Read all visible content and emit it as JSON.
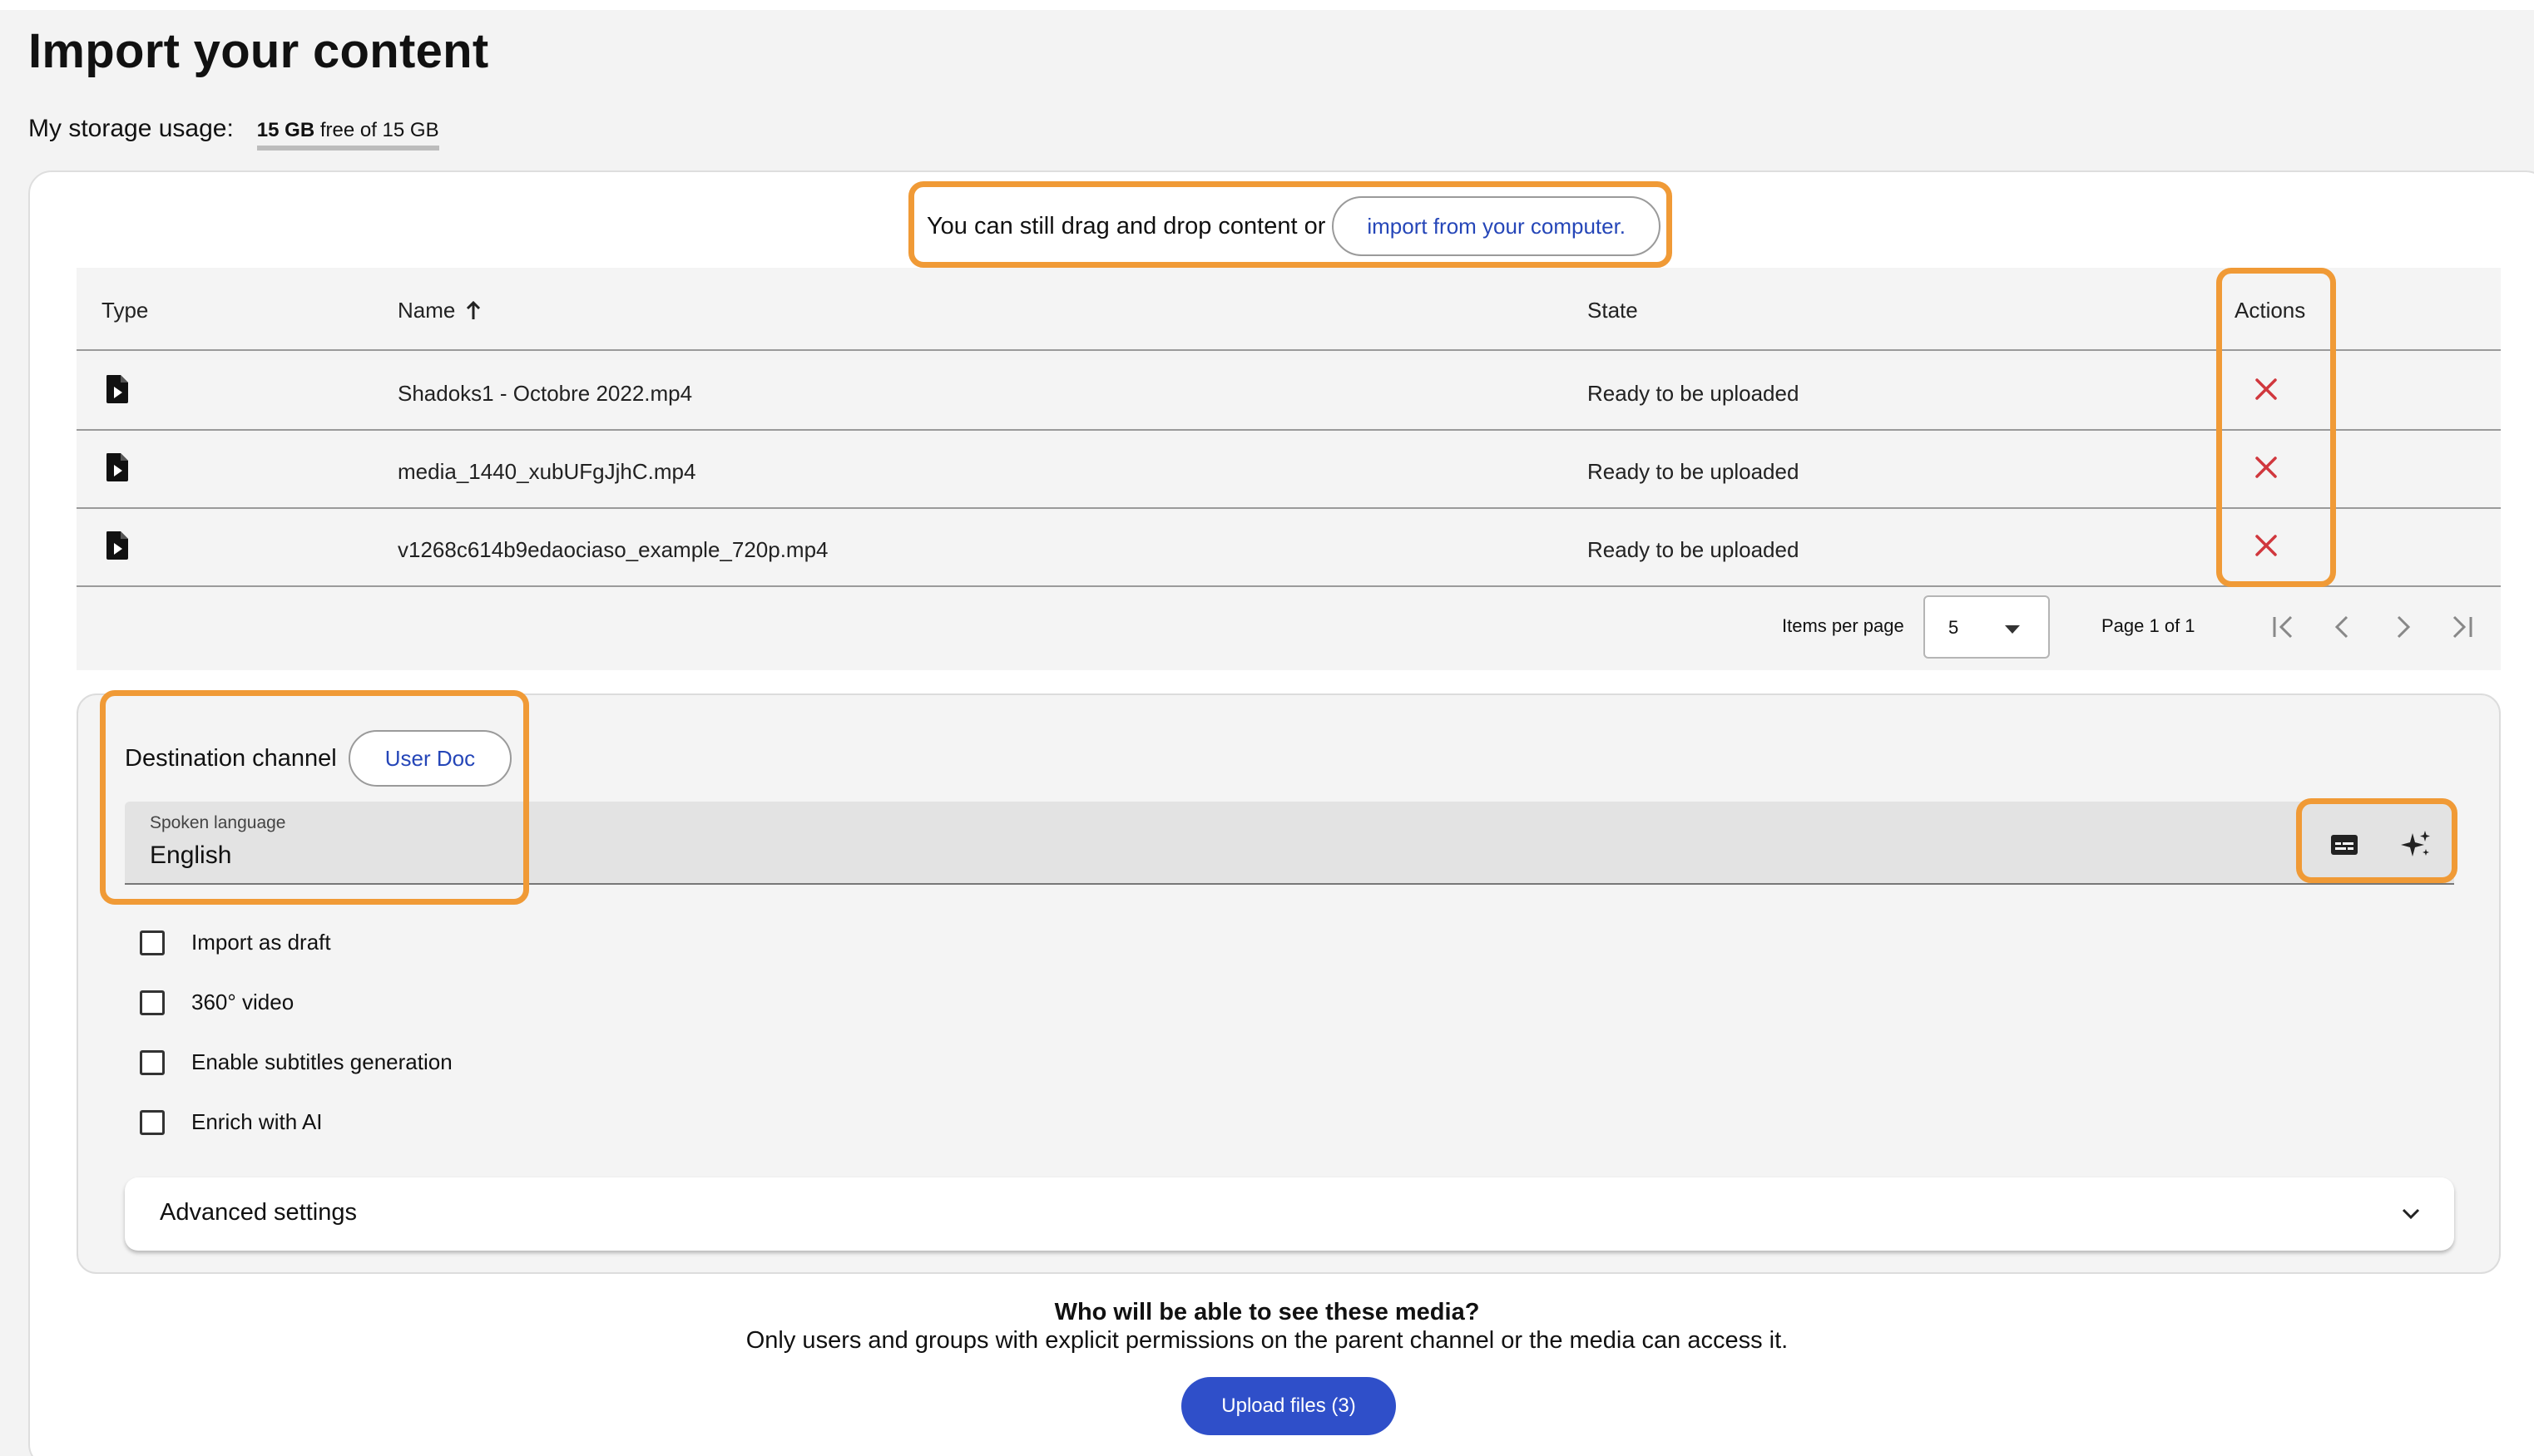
{
  "page": {
    "title": "Import your content",
    "storage_label": "My storage usage:",
    "storage_free": "15 GB",
    "storage_rest": "free of 15 GB"
  },
  "dropzone": {
    "text": "You can still drag and drop content or",
    "import_link": "import from your computer."
  },
  "table": {
    "headers": {
      "type": "Type",
      "name": "Name",
      "state": "State",
      "actions": "Actions"
    },
    "rows": [
      {
        "name": "Shadoks1 - Octobre 2022.mp4",
        "state": "Ready to be uploaded"
      },
      {
        "name": "media_1440_xubUFgJjhC.mp4",
        "state": "Ready to be uploaded"
      },
      {
        "name": "v1268c614b9edaociaso_example_720p.mp4",
        "state": "Ready to be uploaded"
      }
    ],
    "pagination": {
      "items_per_page_label": "Items per page",
      "items_per_page": "5",
      "page_info": "Page 1 of 1"
    }
  },
  "settings": {
    "destination_label": "Destination channel",
    "destination_value": "User Doc",
    "spoken_language_label": "Spoken language",
    "spoken_language_value": "English",
    "checkboxes": [
      "Import as draft",
      "360° video",
      "Enable subtitles generation",
      "Enrich with AI"
    ],
    "advanced": "Advanced settings"
  },
  "visibility": {
    "heading": "Who will be able to see these media?",
    "text": "Only users and groups with explicit permissions on the parent channel or the media can access it."
  },
  "upload_button": "Upload files (3)",
  "colors": {
    "accent": "#2f4fc9",
    "link": "#2546b8",
    "highlight": "#f09a36",
    "delete": "#d0373d"
  },
  "icons": [
    "video-file-icon",
    "close-icon",
    "sort-arrow-up-icon",
    "first-page-icon",
    "previous-page-icon",
    "next-page-icon",
    "last-page-icon",
    "subtitles-icon",
    "sparkles-icon",
    "chevron-down-icon",
    "dropdown-triangle-icon"
  ]
}
